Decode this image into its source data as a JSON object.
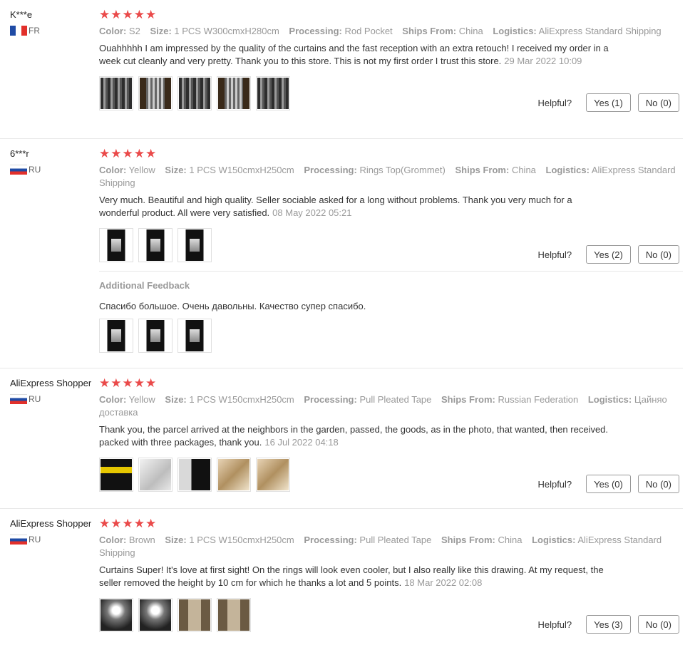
{
  "labels": {
    "color": "Color:",
    "size": "Size:",
    "processing": "Processing:",
    "ships_from": "Ships From:",
    "logistics": "Logistics:",
    "helpful": "Helpful?",
    "additional_feedback": "Additional Feedback"
  },
  "colors": {
    "star": "#ea4a4a",
    "muted": "#999999"
  },
  "reviews": [
    {
      "user": "K***e",
      "country": "FR",
      "rating": 5,
      "stars": "★★★★★",
      "color": "S2",
      "size": "1 PCS W300cmxH280cm",
      "processing": "Rod Pocket",
      "ships_from": "China",
      "logistics": "AliExpress Standard Shipping",
      "text": "Ouahhhhh I am impressed by the quality of the curtains and the fast reception with an extra retouch! I received my order in a week cut cleanly and very pretty. Thank you to this store. This is not my first order I trust this store.",
      "date": "29 Mar 2022 10:09",
      "yes": "Yes (1)",
      "no": "No (0)"
    },
    {
      "user": "6***r",
      "country": "RU",
      "rating": 5,
      "stars": "★★★★★",
      "color": "Yellow",
      "size": "1 PCS W150cmxH250cm",
      "processing": "Rings Top(Grommet)",
      "ships_from": "China",
      "logistics": "AliExpress Standard Shipping",
      "text": "Very much. Beautiful and high quality. Seller sociable asked for a long without problems. Thank you very much for a wonderful product. All were very satisfied.",
      "date": "08 May 2022 05:21",
      "yes": "Yes (2)",
      "no": "No (0)",
      "additional_text": "Спасибо большое. Очень давольны. Качество супер спасибо."
    },
    {
      "user": "AliExpress Shopper",
      "country": "RU",
      "rating": 5,
      "stars": "★★★★★",
      "color": "Yellow",
      "size": "1 PCS W150cmxH250cm",
      "processing": "Pull Pleated Tape",
      "ships_from": "Russian Federation",
      "logistics": "Цайняо доставка",
      "text": "Thank you, the parcel arrived at the neighbors in the garden, passed, the goods, as in the photo, that wanted, then received. packed with three packages, thank you.",
      "date": "16 Jul 2022 04:18",
      "yes": "Yes (0)",
      "no": "No (0)"
    },
    {
      "user": "AliExpress Shopper",
      "country": "RU",
      "rating": 5,
      "stars": "★★★★★",
      "color": "Brown",
      "size": "1 PCS W150cmxH250cm",
      "processing": "Pull Pleated Tape",
      "ships_from": "China",
      "logistics": "AliExpress Standard Shipping",
      "text": "Curtains Super! It's love at first sight! On the rings will look even cooler, but I also really like this drawing. At my request, the seller removed the height by 10 cm for which he thanks a lot and 5 points.",
      "date": "18 Mar 2022 02:08",
      "yes": "Yes (3)",
      "no": "No (0)"
    }
  ]
}
